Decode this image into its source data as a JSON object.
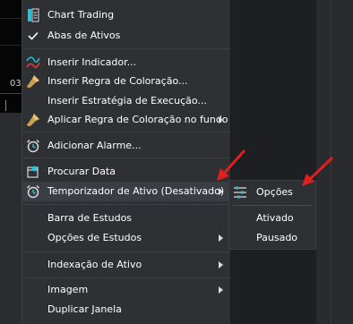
{
  "background": {
    "chart_axis_label": "03"
  },
  "menu": {
    "items": [
      {
        "label": "Chart Trading",
        "icon": "chart-trading-icon",
        "submenu": false
      },
      {
        "label": "Abas de Ativos",
        "icon": "checkmark-icon",
        "submenu": false
      },
      {
        "label": "Inserir Indicador...",
        "icon": "indicator-icon",
        "submenu": false
      },
      {
        "label": "Inserir Regra de Coloração...",
        "icon": "paint-brush-icon",
        "submenu": false
      },
      {
        "label": "Inserir Estratégia de Execução...",
        "icon": "",
        "submenu": false
      },
      {
        "label": "Aplicar Regra de Coloração no fundo",
        "icon": "paint-brush-icon",
        "submenu": true
      },
      {
        "label": "Adicionar Alarme...",
        "icon": "alarm-clock-icon",
        "submenu": false
      },
      {
        "label": "Procurar Data",
        "icon": "search-date-icon",
        "submenu": false
      },
      {
        "label": "Temporizador de Ativo (Desativado)",
        "icon": "timer-icon",
        "submenu": true
      },
      {
        "label": "Barra de Estudos",
        "icon": "",
        "submenu": false
      },
      {
        "label": "Opções de Estudos",
        "icon": "",
        "submenu": true
      },
      {
        "label": "Indexação de Ativo",
        "icon": "",
        "submenu": true
      },
      {
        "label": "Imagem",
        "icon": "",
        "submenu": true
      },
      {
        "label": "Duplicar Janela",
        "icon": "",
        "submenu": false
      }
    ]
  },
  "submenu": {
    "items": [
      {
        "label": "Opções",
        "icon": "sliders-icon"
      },
      {
        "label": "Ativado"
      },
      {
        "label": "Pausado"
      }
    ]
  },
  "colors": {
    "menu_bg": "#2f3033",
    "highlight": "#3b3d44",
    "annotation_arrow": "#e02020",
    "accent_cyan": "#27c1d8"
  }
}
